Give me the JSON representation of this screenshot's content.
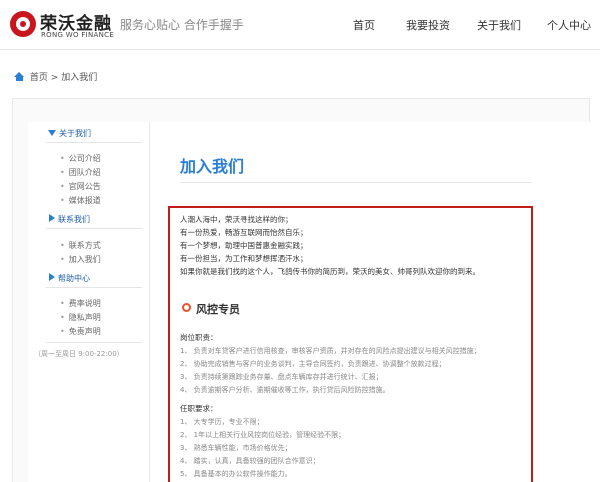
{
  "header": {
    "logo_cn": "荣沃金融",
    "logo_en": "RONG WO FINANCE",
    "slogan": "服务心贴心 合作手握手",
    "nav": [
      "首页",
      "我要投资",
      "关于我们",
      "个人中心"
    ]
  },
  "breadcrumb": {
    "home": "首页",
    "sep": ">",
    "current": "加入我们"
  },
  "sidebar": {
    "groups": [
      {
        "title": "关于我们",
        "expanded": true,
        "items": [
          "公司介绍",
          "团队介绍",
          "官网公告",
          "媒体报道"
        ]
      },
      {
        "title": "联系我们",
        "expanded": false,
        "items": [
          "联系方式",
          "加入我们"
        ]
      },
      {
        "title": "帮助中心",
        "expanded": false,
        "items": [
          "费率说明",
          "隐私声明",
          "免责声明"
        ]
      }
    ],
    "hours": "（周一至周日 9:00-22:00）"
  },
  "main": {
    "title": "加入我们",
    "intro": [
      "人潮人海中，荣沃寻找这样的你；",
      "有一份热爱，畅游互联网而怡然自乐；",
      "有一个梦想，助理中国普惠金融实践；",
      "有一份担当，为工作和梦想挥洒汗水；",
      "如果你就是我们找的这个人，飞鸽传书你的简历到，荣沃的美女、帅哥列队欢迎你的到来。"
    ],
    "position_title": "风控专员",
    "duties_heading": "岗位职责：",
    "duties": [
      "1、 负责对车贷客户进行信用核查，审核客户资质，并对存在的风险点提出建议与相关风控措施；",
      "2、 协助完成销售与客户的业务谈判，主导合同签约，负责跟进、协调整个放款过程；",
      "3、 负责持续第跟踪业务存量、盘点车辆库存并进行统计、汇报；",
      "4、 负责逾期客户分析、逾期催收等工作，执行贷后风险防控措施。"
    ],
    "requirements_heading": "任职要求：",
    "requirements": [
      "1、 大专学历，专业不限；",
      "2、 1年以上相关行业风控岗位经验，管理经验不限；",
      "3、 熟悉车辆性能，市场价格优先；",
      "4、 踏实，认真，具备较强的团队合作意识；",
      "5、 具备基本的办公软件操作能力。"
    ]
  }
}
